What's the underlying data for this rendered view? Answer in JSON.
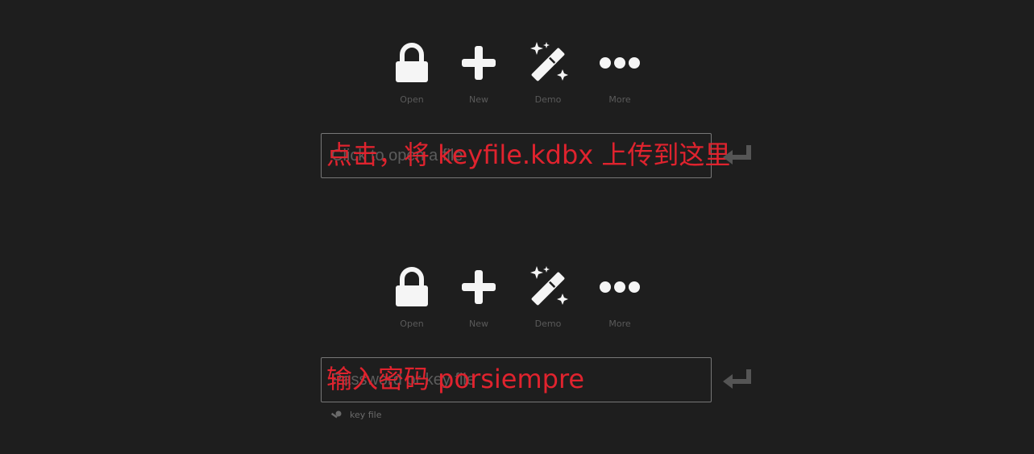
{
  "toolbar": {
    "open_label": "Open",
    "new_label": "New",
    "demo_label": "Demo",
    "more_label": "More"
  },
  "panel1": {
    "placeholder": "Click to open a file",
    "annotation": "点击，将 keyfile.kdbx 上传到这里"
  },
  "panel2": {
    "placeholder": "Password or key file",
    "annotation": "输入密码  porsiempre",
    "keyfile_label": "key file"
  },
  "icons": {
    "open": "lock-icon",
    "new": "plus-icon",
    "demo": "magic-wand-icon",
    "more": "ellipsis-icon",
    "enter": "enter-arrow-icon",
    "keyfile": "key-icon"
  },
  "colors": {
    "background": "#1e1e1e",
    "icon": "#f5f5f5",
    "label": "#5a5a5a",
    "annotation": "#e0232e",
    "border": "#777777"
  }
}
